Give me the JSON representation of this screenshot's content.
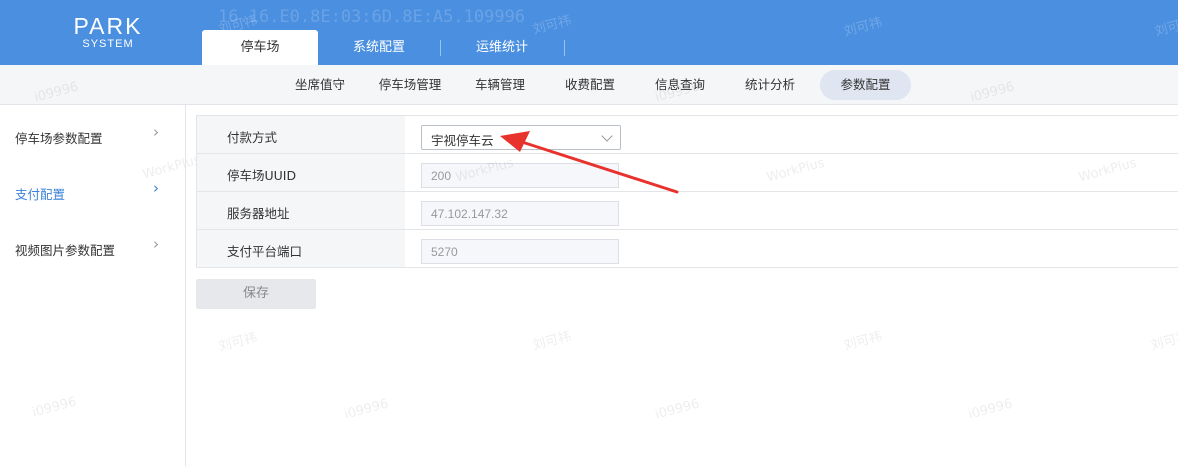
{
  "brand": {
    "line1": "PARK",
    "line2": "SYSTEM"
  },
  "header_faint_text": "16.16.E0.8E:03:6D.8E:A5.109996",
  "top_tabs": [
    {
      "label": "停车场",
      "active": true
    },
    {
      "label": "系统配置",
      "active": false
    },
    {
      "label": "运维统计",
      "active": false
    }
  ],
  "subnav": [
    {
      "label": "坐席值守"
    },
    {
      "label": "停车场管理"
    },
    {
      "label": "车辆管理"
    },
    {
      "label": "收费配置"
    },
    {
      "label": "信息查询"
    },
    {
      "label": "统计分析"
    },
    {
      "label": "参数配置",
      "active": true
    }
  ],
  "sidebar": [
    {
      "label": "停车场参数配置",
      "active": false
    },
    {
      "label": "支付配置",
      "active": true
    },
    {
      "label": "视频图片参数配置",
      "active": false
    }
  ],
  "form": {
    "payment_method": {
      "label": "付款方式",
      "value": "宇视停车云"
    },
    "parking_uuid": {
      "label": "停车场UUID",
      "value": "200"
    },
    "server_address": {
      "label": "服务器地址",
      "value": "47.102.147.32"
    },
    "payment_port": {
      "label": "支付平台端口",
      "value": "5270"
    }
  },
  "save_label": "保存",
  "watermark": {
    "name": "刘可祎",
    "id": "i09996",
    "brand": "WorkPlus"
  },
  "colors": {
    "header": "#4a8fe0",
    "accent": "#3b82d8",
    "arrow": "#e8322e"
  }
}
